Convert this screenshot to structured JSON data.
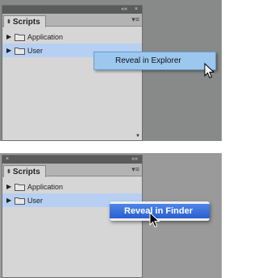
{
  "windows_panel": {
    "title_controls": [
      "««",
      "×"
    ],
    "tab_label": "Scripts",
    "tree": [
      {
        "label": "Application"
      },
      {
        "label": "User"
      }
    ],
    "context_menu_item": "Reveal in Explorer"
  },
  "mac_panel": {
    "title_controls": [
      "×",
      "««"
    ],
    "tab_label": "Scripts",
    "tree": [
      {
        "label": "Application"
      },
      {
        "label": "User"
      }
    ],
    "context_menu_item": "Reveal in Finder"
  },
  "icons": {
    "disclosure": "▶",
    "tab_arrows": "⬍",
    "panel_menu": "▾≡",
    "scroll_down": "▼",
    "folder": "folder-icon",
    "cursor": "arrow-cursor"
  }
}
